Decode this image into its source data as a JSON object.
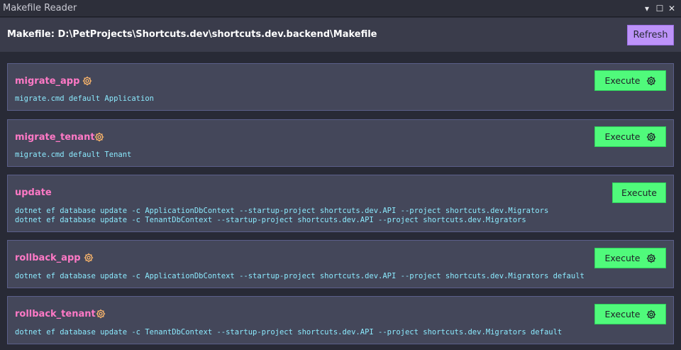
{
  "window": {
    "title": "Makefile Reader",
    "controls": [
      "▾",
      "☐",
      "✕"
    ]
  },
  "header": {
    "title": "Makefile: D:\\PetProjects\\Shortcuts.dev\\shortcuts.dev.backend\\Makefile",
    "refresh_label": "Refresh"
  },
  "targets": [
    {
      "name": "migrate_app",
      "has_gear": true,
      "commands": [
        "migrate.cmd default Application"
      ],
      "execute_label": "Execute"
    },
    {
      "name": "migrate_tenant",
      "has_gear": true,
      "commands": [
        "migrate.cmd default Tenant"
      ],
      "execute_label": "Execute"
    },
    {
      "name": "update",
      "has_gear": false,
      "commands": [
        "dotnet ef database update -c ApplicationDbContext --startup-project shortcuts.dev.API --project shortcuts.dev.Migrators",
        "dotnet ef database update -c TenantDbContext --startup-project shortcuts.dev.API --project shortcuts.dev.Migrators"
      ],
      "execute_label": "Execute"
    },
    {
      "name": "rollback_app",
      "has_gear": true,
      "commands": [
        "dotnet ef database update -c ApplicationDbContext --startup-project shortcuts.dev.API --project shortcuts.dev.Migrators default"
      ],
      "execute_label": "Execute"
    },
    {
      "name": "rollback_tenant",
      "has_gear": true,
      "commands": [
        "dotnet ef database update -c TenantDbContext --startup-project shortcuts.dev.API --project shortcuts.dev.Migrators default"
      ],
      "execute_label": "Execute"
    }
  ],
  "colors": {
    "background": "#282a36",
    "card": "#44475a",
    "target_name": "#ff79c6",
    "command": "#8be9fd",
    "execute": "#50fa7b",
    "refresh": "#bd93f9",
    "gear": "#ffb86c"
  },
  "icons": {
    "target_gear": "gear-icon",
    "button_gear": "gear-icon"
  }
}
